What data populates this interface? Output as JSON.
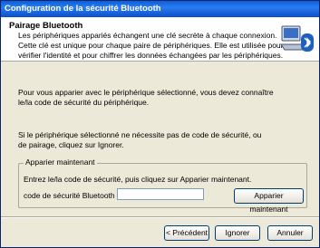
{
  "window": {
    "title": "Configuration de la sécurité Bluetooth"
  },
  "header": {
    "title": "Pairage Bluetooth",
    "description": "Les périphériques appariés échangent une clé secrète à chaque connexion. Cette clé est unique pour chaque paire de périphériques. Elle est utilisée pour vérifier l'identité et pour chiffrer les données échangées par les périphériques."
  },
  "body": {
    "para1": "Pour vous apparier avec le périphérique sélectionné, vous devez connaître le/la code de sécurité du périphérique.",
    "para2": "Si le périphérique sélectionné ne nécessite pas de code de sécurité, ou de pairage, cliquez sur Ignorer."
  },
  "pair_group": {
    "label": "Apparier maintenant",
    "instruction": "Entrez le/la code de sécurité, puis cliquez sur Apparier maintenant.",
    "field_label": "code de sécurité Bluetooth :",
    "field_value": "",
    "button_label": "Apparier maintenant"
  },
  "footer": {
    "prev_label": "< Précédent",
    "ignore_label": "Ignorer",
    "cancel_label": "Annuler"
  },
  "icons": {
    "header_icon": "bluetooth-computer-icon"
  }
}
